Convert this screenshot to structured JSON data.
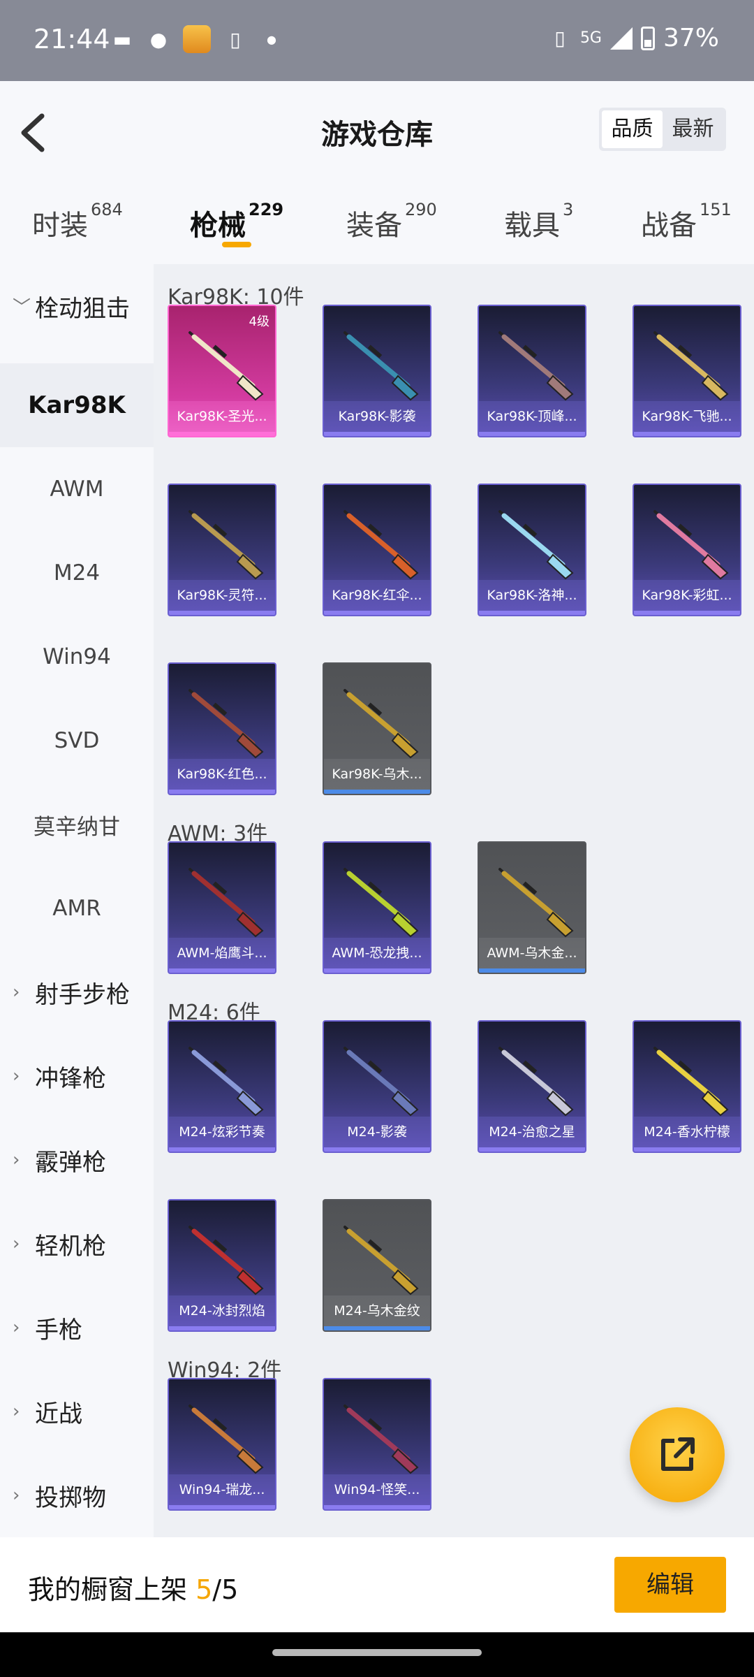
{
  "status_bar": {
    "time": "21:44",
    "network": "5G",
    "battery": "37%"
  },
  "header": {
    "title": "游戏仓库",
    "sort_options": [
      {
        "label": "品质",
        "active": true
      },
      {
        "label": "最新",
        "active": false
      }
    ]
  },
  "tabs": [
    {
      "label": "时装",
      "count": "684"
    },
    {
      "label": "枪械",
      "count": "229",
      "active": true
    },
    {
      "label": "装备",
      "count": "290"
    },
    {
      "label": "载具",
      "count": "3"
    },
    {
      "label": "战备",
      "count": "151"
    }
  ],
  "sidebar": {
    "group_open": "栓动狙击",
    "items": [
      "Kar98K",
      "AWM",
      "M24",
      "Win94",
      "SVD",
      "莫辛纳甘",
      "AMR"
    ],
    "active_item": "Kar98K",
    "groups": [
      "射手步枪",
      "冲锋枪",
      "霰弹枪",
      "轻机枪",
      "手枪",
      "近战",
      "投掷物"
    ]
  },
  "sections": [
    {
      "title": "Kar98K: 10件",
      "items": [
        {
          "name": "Kar98K-圣光...",
          "rarity": "gold",
          "level": "4级",
          "color": "#f0e6c8"
        },
        {
          "name": "Kar98K-影袭",
          "rarity": "purple",
          "color": "#3a8fb0"
        },
        {
          "name": "Kar98K-顶峰...",
          "rarity": "purple",
          "color": "#a07a7a"
        },
        {
          "name": "Kar98K-飞驰...",
          "rarity": "purple",
          "color": "#d8b860"
        },
        {
          "name": "Kar98K-灵符...",
          "rarity": "purple",
          "color": "#b89a50"
        },
        {
          "name": "Kar98K-红伞...",
          "rarity": "purple",
          "color": "#d8602a"
        },
        {
          "name": "Kar98K-洛神...",
          "rarity": "purple",
          "color": "#9ad8f0"
        },
        {
          "name": "Kar98K-彩虹...",
          "rarity": "purple",
          "color": "#e07aa0"
        },
        {
          "name": "Kar98K-红色...",
          "rarity": "purple",
          "color": "#a04a3a"
        },
        {
          "name": "Kar98K-乌木...",
          "rarity": "grey",
          "color": "#c8a030"
        }
      ]
    },
    {
      "title": "AWM: 3件",
      "items": [
        {
          "name": "AWM-焰鹰斗...",
          "rarity": "purple",
          "color": "#a03030"
        },
        {
          "name": "AWM-恐龙拽...",
          "rarity": "purple",
          "color": "#b8d030"
        },
        {
          "name": "AWM-乌木金...",
          "rarity": "grey",
          "color": "#c8a030"
        }
      ]
    },
    {
      "title": "M24: 6件",
      "items": [
        {
          "name": "M24-炫彩节奏",
          "rarity": "purple",
          "color": "#8a9ad8"
        },
        {
          "name": "M24-影袭",
          "rarity": "purple",
          "color": "#6a7ab8"
        },
        {
          "name": "M24-治愈之星",
          "rarity": "purple",
          "color": "#c8c8d8"
        },
        {
          "name": "M24-香水柠檬",
          "rarity": "purple",
          "color": "#e8d040"
        },
        {
          "name": "M24-冰封烈焰",
          "rarity": "purple",
          "color": "#c03030"
        },
        {
          "name": "M24-乌木金纹",
          "rarity": "grey",
          "color": "#c8a030"
        }
      ]
    },
    {
      "title": "Win94: 2件",
      "items": [
        {
          "name": "Win94-瑞龙...",
          "rarity": "purple",
          "color": "#c87a3a"
        },
        {
          "name": "Win94-怪笑...",
          "rarity": "purple",
          "color": "#a03a5a"
        }
      ]
    }
  ],
  "bottom_bar": {
    "label": "我的橱窗上架 ",
    "count": "5",
    "total": "/5",
    "edit_label": "编辑"
  }
}
